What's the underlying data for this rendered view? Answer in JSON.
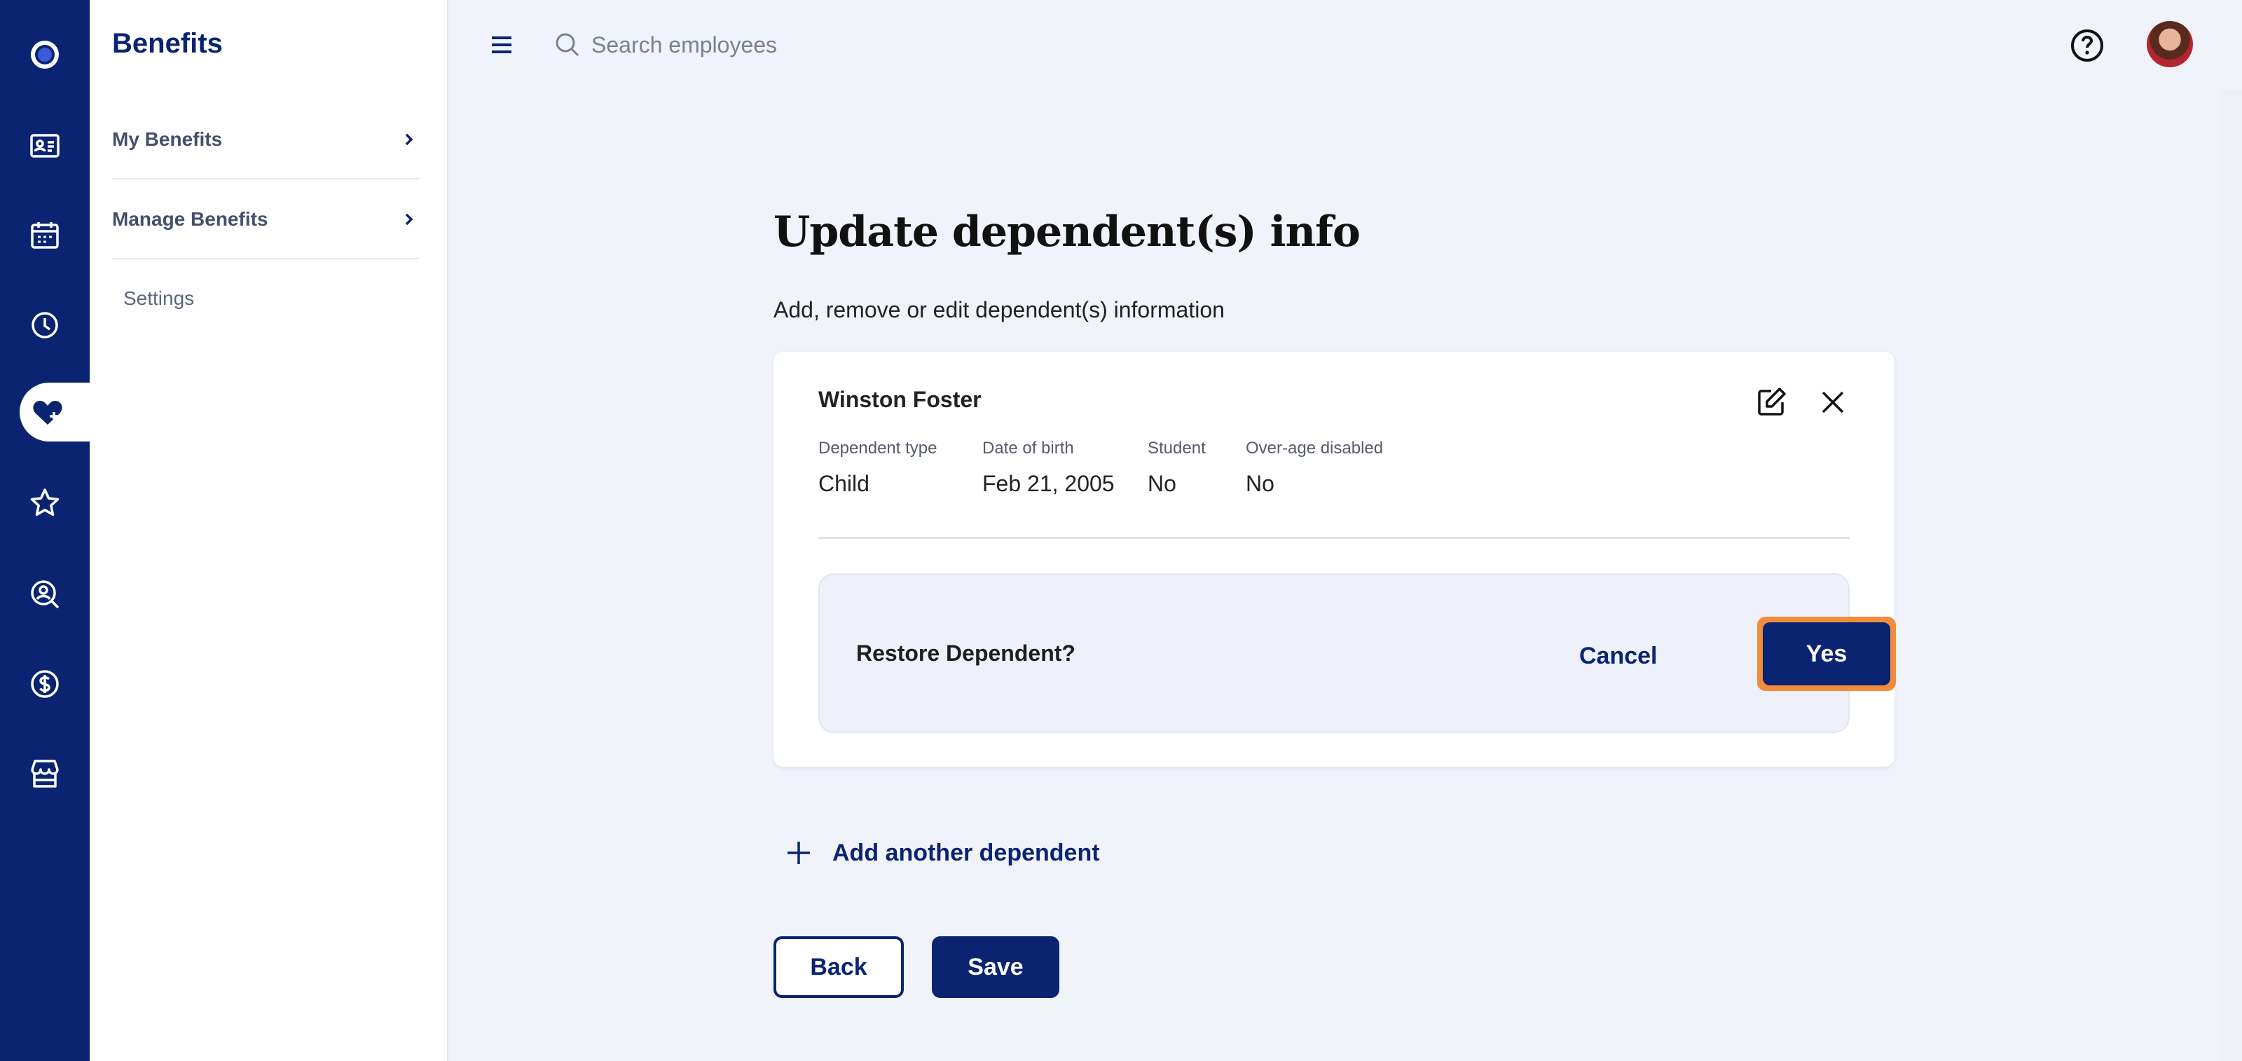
{
  "colors": {
    "brand": "#0a2472",
    "background": "#f0f3fa",
    "focus_outline": "#f28c3c"
  },
  "rail": {
    "icons": [
      "logo-icon",
      "id-card-icon",
      "calendar-icon",
      "clock-icon",
      "heart-plus-icon",
      "star-icon",
      "user-search-icon",
      "dollar-icon",
      "store-icon"
    ],
    "active": "heart-plus-icon"
  },
  "sidenav": {
    "title": "Benefits",
    "items": [
      {
        "label": "My Benefits"
      },
      {
        "label": "Manage Benefits"
      }
    ],
    "sub_item": "Settings"
  },
  "topbar": {
    "search_placeholder": "Search employees"
  },
  "page": {
    "title": "Update dependent(s) info",
    "subtitle": "Add, remove or edit dependent(s) information"
  },
  "dependent": {
    "name": "Winston Foster",
    "fields": [
      {
        "label": "Dependent type",
        "value": "Child"
      },
      {
        "label": "Date of birth",
        "value": "Feb 21, 2005"
      },
      {
        "label": "Student",
        "value": "No"
      },
      {
        "label": "Over-age disabled",
        "value": "No"
      }
    ]
  },
  "confirm": {
    "question": "Restore Dependent?",
    "cancel_label": "Cancel",
    "yes_label": "Yes"
  },
  "actions": {
    "add_dependent_label": "Add another dependent",
    "back_label": "Back",
    "save_label": "Save"
  }
}
